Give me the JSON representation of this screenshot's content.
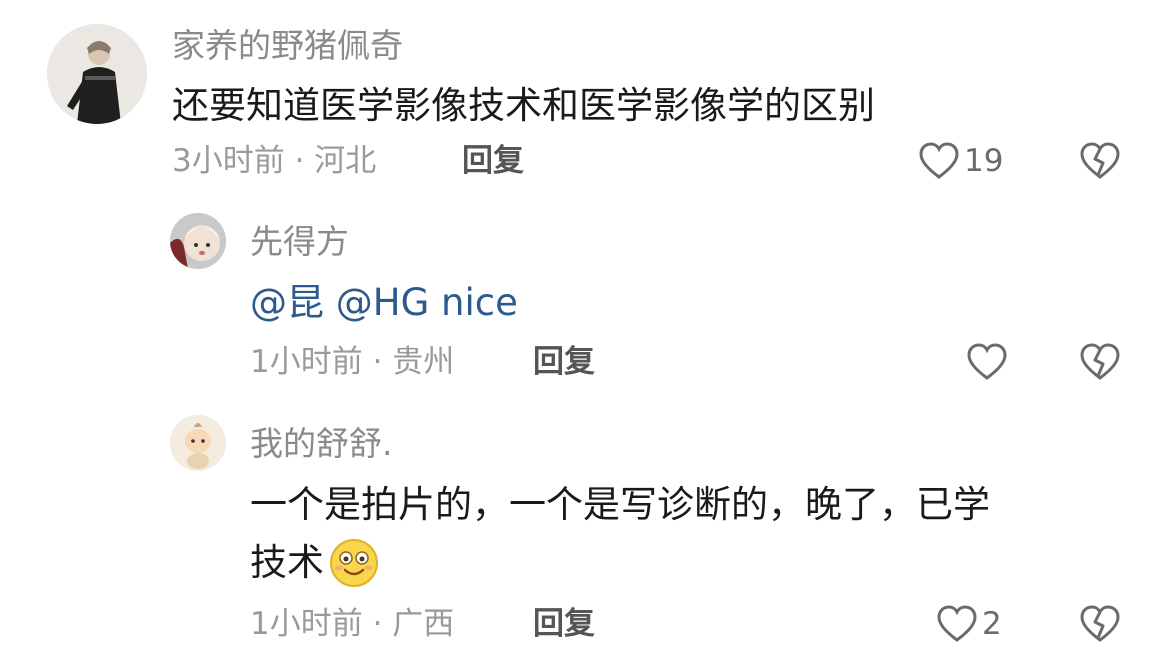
{
  "comments": [
    {
      "username": "家养的野猪佩奇",
      "text": "还要知道医学影像技术和医学影像学的区别",
      "meta": "3小时前 · 河北",
      "reply_label": "回复",
      "like_count": "19"
    },
    {
      "username": "先得方",
      "mention_1": "@昆",
      "mention_2": "@HG",
      "text_tail": "nice",
      "meta": "1小时前 · 贵州",
      "reply_label": "回复",
      "like_count": ""
    },
    {
      "username": "我的舒舒.",
      "line_1": "一个是拍片的，一个是写诊断的，晚了，已学",
      "line_2": "技术",
      "emoji": "smiling-face-emoji",
      "meta": "1小时前 · 广西",
      "reply_label": "回复",
      "like_count": "2"
    }
  ],
  "colors": {
    "mention": "#2d5a8e",
    "username": "#8a8a8a",
    "text": "#1a1a1a",
    "meta": "#9a9a9a"
  }
}
